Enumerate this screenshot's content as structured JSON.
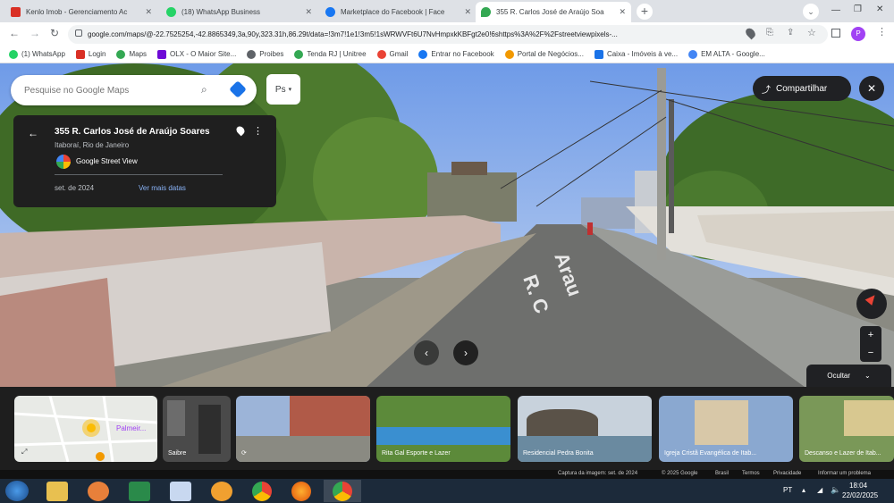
{
  "tabs": [
    {
      "title": "Kenlo Imob - Gerenciamento Ac",
      "fav": "#d93025"
    },
    {
      "title": "(18) WhatsApp Business",
      "fav": "#25d366"
    },
    {
      "title": "Marketplace do Facebook | Face",
      "fav": "#1877f2"
    },
    {
      "title": "355 R. Carlos José de Araújo Soa",
      "fav": "#34a853"
    }
  ],
  "toolbar": {
    "url": "google.com/maps/@-22.7525254,-42.8865349,3a,90y,323.31h,86.29t/data=!3m7!1e1!3m5!1sWRWVFt6U7NvHmpxkKBFgt2e0!6shttps%3A%2F%2Fstreetviewpixels-..."
  },
  "bookmarks": [
    {
      "label": "(1) WhatsApp",
      "color": "#25d366"
    },
    {
      "label": "Login",
      "color": "#d93025"
    },
    {
      "label": "Maps",
      "color": "#34a853"
    },
    {
      "label": "OLX - O Maior Site...",
      "color": "#6e0ad6"
    },
    {
      "label": "Proibes",
      "color": "#5f6368"
    },
    {
      "label": "Tenda RJ | Unitree",
      "color": "#34a853"
    },
    {
      "label": "Gmail",
      "color": "#ea4335"
    },
    {
      "label": "Entrar no Facebook",
      "color": "#1877f2"
    },
    {
      "label": "Portal de Negócios...",
      "color": "#f29900"
    },
    {
      "label": "Caixa - Imóveis à ve...",
      "color": "#1a73e8"
    },
    {
      "label": "EM ALTA - Google...",
      "color": "#4285f4"
    }
  ],
  "search": {
    "placeholder": "Pesquise no Google Maps"
  },
  "layer_label": "Ps",
  "info": {
    "title": "355 R. Carlos José de Araújo Soares",
    "subtitle": "Itaboraí, Rio de Janeiro",
    "source": "Google Street View",
    "date": "set. de 2024",
    "more": "Ver mais datas"
  },
  "share_label": "Compartilhar",
  "road_text": "R. C... Arau...",
  "hide_label": "Ocultar",
  "thumbs": [
    {
      "caption": "Palmeir..."
    },
    {
      "caption": "Saibre"
    },
    {
      "caption": ""
    },
    {
      "caption": "Rita Gal Esporte e Lazer"
    },
    {
      "caption": "Residencial Pedra Bonita"
    },
    {
      "caption": "Igreja Cristã Evangélica de Itab..."
    },
    {
      "caption": "Descanso e Lazer de Itab..."
    }
  ],
  "footer": {
    "capture": "Captura da imagem: set. de 2024",
    "copyright": "© 2025 Google",
    "links": [
      "Brasil",
      "Termos",
      "Privacidade",
      "Informar um problema"
    ]
  },
  "taskbar": {
    "lang": "PT",
    "time": "18:04",
    "date": "22/02/2025"
  }
}
